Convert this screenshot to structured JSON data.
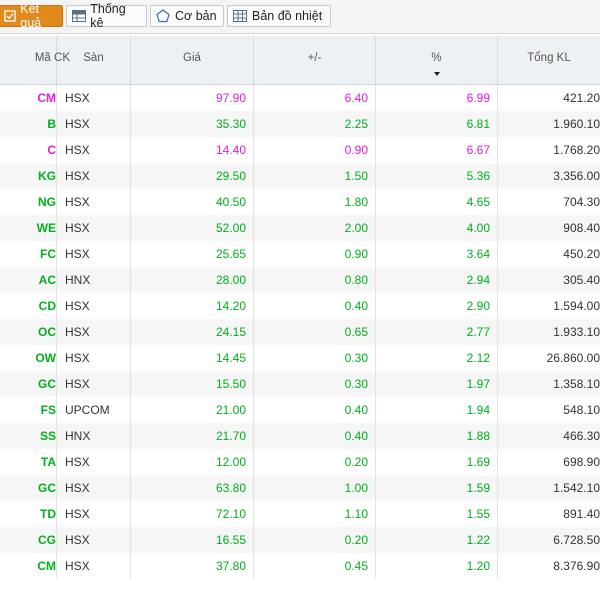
{
  "toolbar": {
    "tabs": [
      {
        "label": "Kết quả",
        "icon": "results-icon",
        "active": true
      },
      {
        "label": "Thống kê",
        "icon": "statistics-grid-icon",
        "active": false
      },
      {
        "label": "Cơ bản",
        "icon": "pentagon-icon",
        "active": false
      },
      {
        "label": "Bản đồ nhiệt",
        "icon": "heatmap-grid-icon",
        "active": false
      }
    ]
  },
  "table": {
    "headers": [
      "Mã CK",
      "Sàn",
      "Giá",
      "+/-",
      "%",
      "Tổng KL"
    ],
    "sorted_column": "%",
    "sort_direction": "descending",
    "colors": {
      "ceiling": "#e01ee0",
      "up": "#00b01c"
    },
    "rows": [
      {
        "code": "CM",
        "exchange": "HSX",
        "price": "97.90",
        "change": "6.40",
        "percent": "6.99",
        "volume": "421.20",
        "status": "ceil"
      },
      {
        "code": "B",
        "exchange": "HSX",
        "price": "35.30",
        "change": "2.25",
        "percent": "6.81",
        "volume": "1.960.10",
        "status": "up"
      },
      {
        "code": "C",
        "exchange": "HSX",
        "price": "14.40",
        "change": "0.90",
        "percent": "6.67",
        "volume": "1.768.20",
        "status": "ceil"
      },
      {
        "code": "KG",
        "exchange": "HSX",
        "price": "29.50",
        "change": "1.50",
        "percent": "5.36",
        "volume": "3.356.00",
        "status": "up"
      },
      {
        "code": "NG",
        "exchange": "HSX",
        "price": "40.50",
        "change": "1.80",
        "percent": "4.65",
        "volume": "704.30",
        "status": "up"
      },
      {
        "code": "WE",
        "exchange": "HSX",
        "price": "52.00",
        "change": "2.00",
        "percent": "4.00",
        "volume": "908.40",
        "status": "up"
      },
      {
        "code": "FC",
        "exchange": "HSX",
        "price": "25.65",
        "change": "0.90",
        "percent": "3.64",
        "volume": "450.20",
        "status": "up"
      },
      {
        "code": "AC",
        "exchange": "HNX",
        "price": "28.00",
        "change": "0.80",
        "percent": "2.94",
        "volume": "305.40",
        "status": "up"
      },
      {
        "code": "CD",
        "exchange": "HSX",
        "price": "14.20",
        "change": "0.40",
        "percent": "2.90",
        "volume": "1.594.00",
        "status": "up"
      },
      {
        "code": "OC",
        "exchange": "HSX",
        "price": "24.15",
        "change": "0.65",
        "percent": "2.77",
        "volume": "1.933.10",
        "status": "up"
      },
      {
        "code": "OW",
        "exchange": "HSX",
        "price": "14.45",
        "change": "0.30",
        "percent": "2.12",
        "volume": "26.860.00",
        "status": "up"
      },
      {
        "code": "GC",
        "exchange": "HSX",
        "price": "15.50",
        "change": "0.30",
        "percent": "1.97",
        "volume": "1.358.10",
        "status": "up"
      },
      {
        "code": "FS",
        "exchange": "UPCOM",
        "price": "21.00",
        "change": "0.40",
        "percent": "1.94",
        "volume": "548.10",
        "status": "up"
      },
      {
        "code": "SS",
        "exchange": "HNX",
        "price": "21.70",
        "change": "0.40",
        "percent": "1.88",
        "volume": "466.30",
        "status": "up"
      },
      {
        "code": "TA",
        "exchange": "HSX",
        "price": "12.00",
        "change": "0.20",
        "percent": "1.69",
        "volume": "698.90",
        "status": "up"
      },
      {
        "code": "GC",
        "exchange": "HSX",
        "price": "63.80",
        "change": "1.00",
        "percent": "1.59",
        "volume": "1.542.10",
        "status": "up"
      },
      {
        "code": "TD",
        "exchange": "HSX",
        "price": "72.10",
        "change": "1.10",
        "percent": "1.55",
        "volume": "891.40",
        "status": "up"
      },
      {
        "code": "CG",
        "exchange": "HSX",
        "price": "16.55",
        "change": "0.20",
        "percent": "1.22",
        "volume": "6.728.50",
        "status": "up"
      },
      {
        "code": "CM",
        "exchange": "HSX",
        "price": "37.80",
        "change": "0.45",
        "percent": "1.20",
        "volume": "8.376.90",
        "status": "up"
      }
    ]
  }
}
